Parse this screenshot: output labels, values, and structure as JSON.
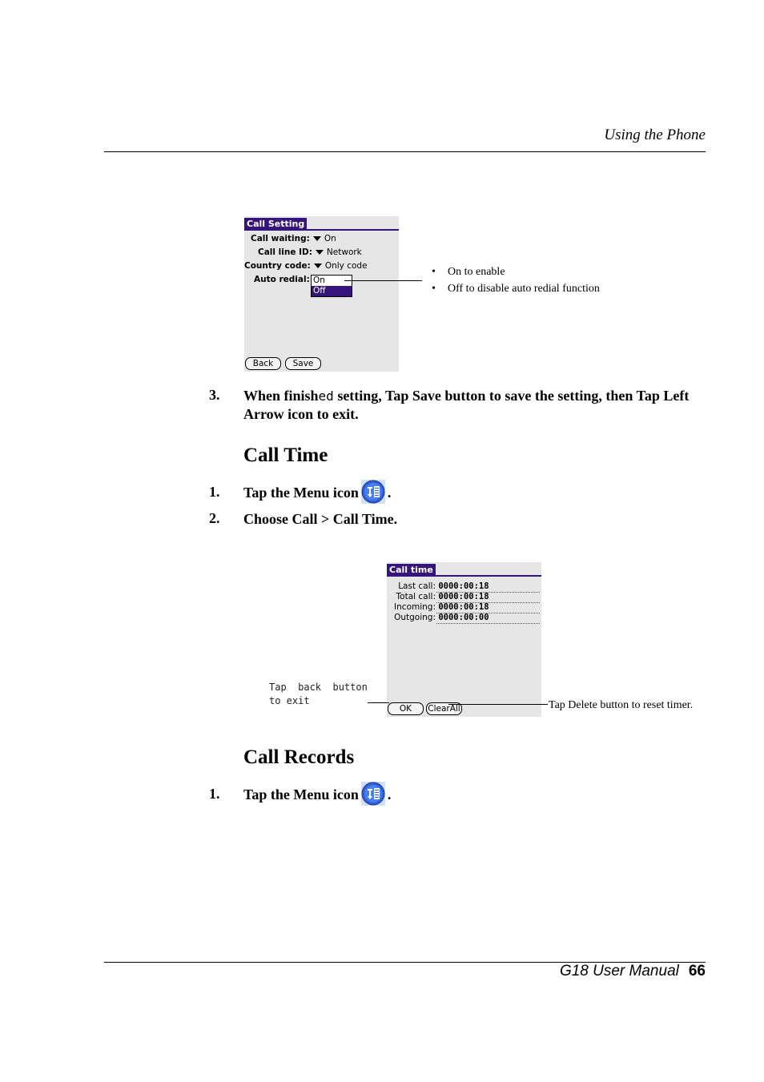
{
  "header": {
    "title": "Using the Phone"
  },
  "call_setting_screen": {
    "title": "Call Setting",
    "rows": [
      {
        "label": "Call waiting:",
        "value": "On"
      },
      {
        "label": "Call line  ID:",
        "value": "Network"
      },
      {
        "label": "Country code:",
        "value": "Only code"
      }
    ],
    "auto_redial_label": "Auto redial:",
    "popup_options": [
      "On",
      "Off"
    ],
    "buttons": {
      "back": "Back",
      "save": "Save"
    }
  },
  "auto_redial_notes": [
    "On to enable",
    "Off to disable auto redial function"
  ],
  "step3": {
    "number": "3.",
    "text_a": "When finish",
    "text_mono": "ed",
    "text_b": " setting, Tap Save button to save the setting, then Tap Left Arrow icon to exit."
  },
  "call_time": {
    "heading": "Call Time",
    "steps": [
      {
        "number": "1.",
        "text": "Tap the Menu icon",
        "suffix": "."
      },
      {
        "number": "2.",
        "text": "Choose Call > Call Time."
      }
    ],
    "screen": {
      "title": "Call time",
      "rows": [
        {
          "label": "Last call:",
          "value": "0000:00:18"
        },
        {
          "label": "Total call:",
          "value": "0000:00:18"
        },
        {
          "label": "Incoming:",
          "value": "0000:00:18"
        },
        {
          "label": "Outgoing:",
          "value": "0000:00:00"
        }
      ],
      "buttons": {
        "ok": "OK",
        "clear_all": "ClearAll"
      }
    },
    "note_left": "Tap  back  button\nto exit",
    "note_right": "Tap Delete button to reset timer."
  },
  "call_records": {
    "heading": "Call Records",
    "steps": [
      {
        "number": "1.",
        "text": "Tap the Menu icon",
        "suffix": "."
      }
    ]
  },
  "footer": {
    "manual": "G18 User Manual",
    "page": "66"
  },
  "colors": {
    "palm_title": "#35157b",
    "screen_bg": "#e6e6e6",
    "menu_icon": "#2f5fd8"
  }
}
